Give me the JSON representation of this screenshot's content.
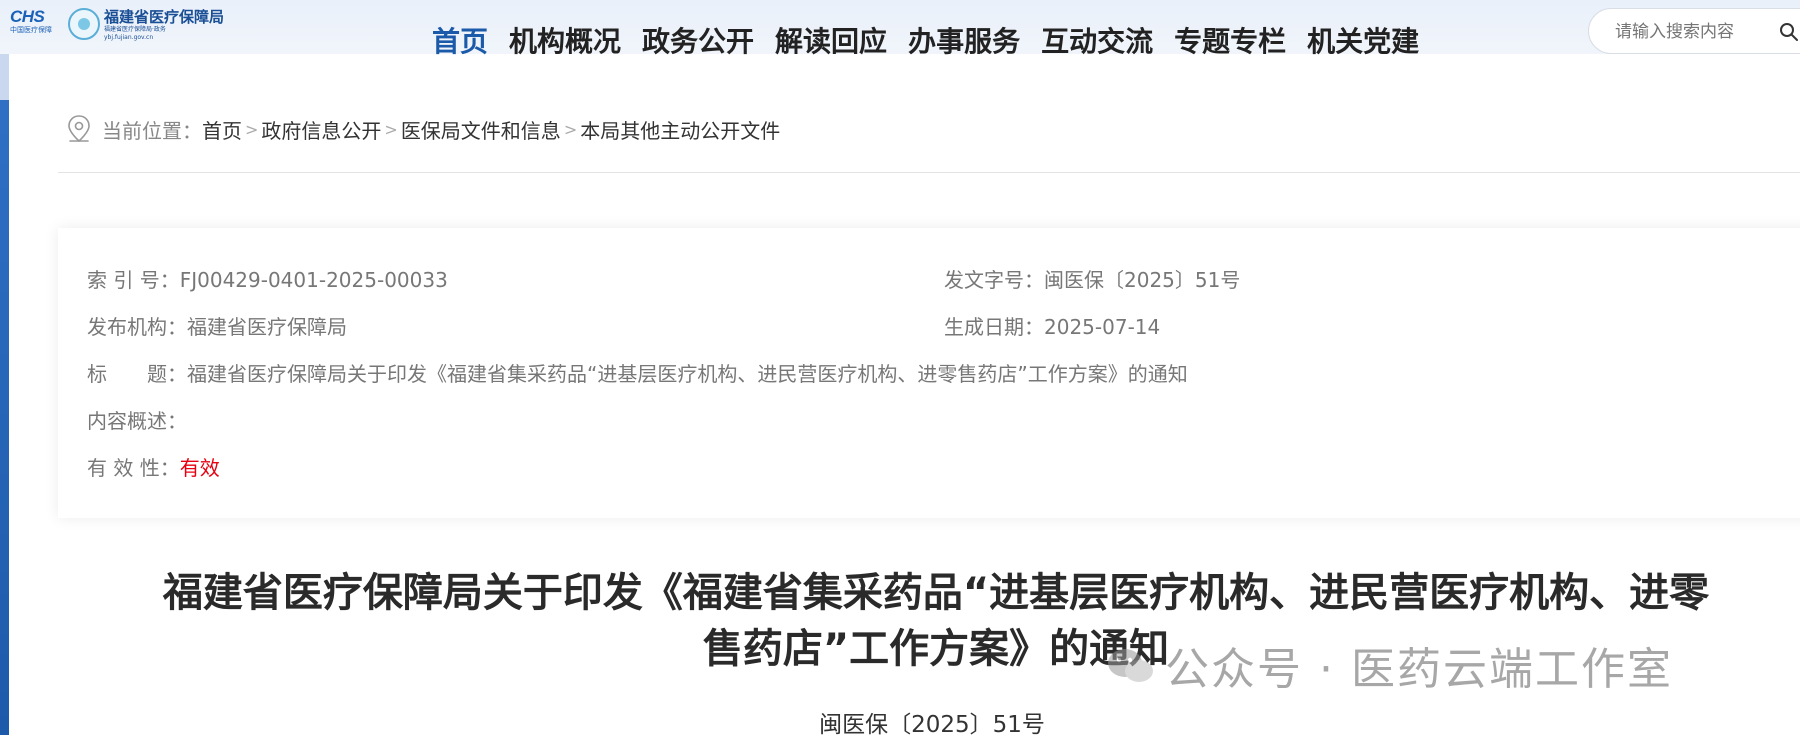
{
  "header": {
    "logo_chs": "CHS",
    "logo_chs_sub": "中国医疗保障",
    "site_name": "福建省医疗保障局",
    "site_name_sub": "福建省医疗保障局·政务",
    "site_domain": "ybj.fujian.gov.cn"
  },
  "nav": {
    "items": [
      {
        "label": "首页",
        "active": true
      },
      {
        "label": "机构概况"
      },
      {
        "label": "政务公开"
      },
      {
        "label": "解读回应"
      },
      {
        "label": "办事服务"
      },
      {
        "label": "互动交流"
      },
      {
        "label": "专题专栏"
      },
      {
        "label": "机关党建"
      }
    ]
  },
  "search": {
    "placeholder": "请输入搜索内容"
  },
  "breadcrumb": {
    "label": "当前位置：",
    "items": [
      "首页",
      "政府信息公开",
      "医保局文件和信息",
      "本局其他主动公开文件"
    ],
    "separator": ">"
  },
  "meta": {
    "index_key": "索 引 号：",
    "index_val": "FJ00429-0401-2025-00033",
    "doc_no_key": "发文字号：",
    "doc_no_val": "闽医保〔2025〕51号",
    "publisher_key": "发布机构：",
    "publisher_val": "福建省医疗保障局",
    "date_key": "生成日期：",
    "date_val": "2025-07-14",
    "title_key": "标　　题：",
    "title_val": "福建省医疗保障局关于印发《福建省集采药品“进基层医疗机构、进民营医疗机构、进零售药店”工作方案》的通知",
    "summary_key": "内容概述：",
    "summary_val": "",
    "validity_key": "有 效 性：",
    "validity_val": "有效"
  },
  "document": {
    "title_line1": "福建省医疗保障局关于印发《福建省集采药品“进基层医疗机构、进民营医疗机构、进零",
    "title_line2": "售药店”工作方案》的通知",
    "number": "闽医保〔2025〕51号"
  },
  "watermark": {
    "text": "公众号 · 医药云端工作室"
  },
  "colors": {
    "nav_active": "#1b5aa8",
    "validity": "#e60012",
    "left_strip": "#2f6fc4"
  }
}
